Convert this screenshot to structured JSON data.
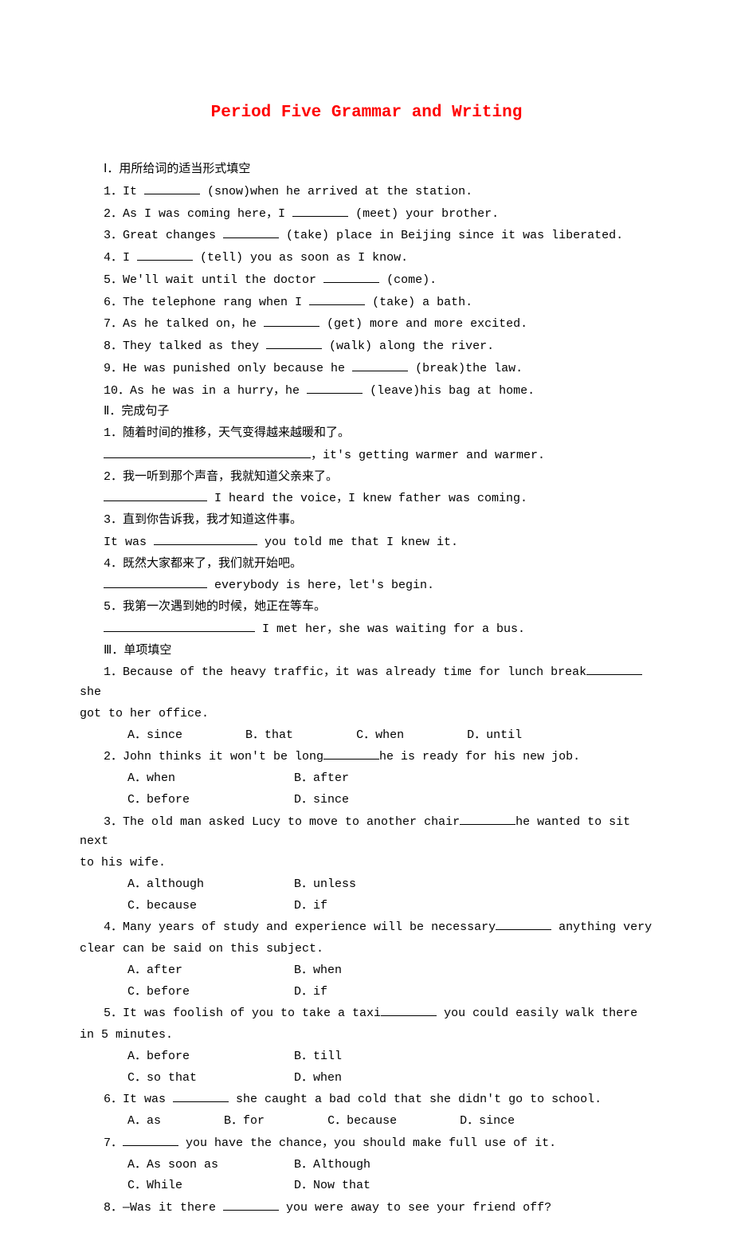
{
  "title": "Period Five  Grammar and Writing",
  "s1": {
    "header": "Ⅰ．用所给词的适当形式填空",
    "items": [
      {
        "n": "1．",
        "pre": "It ",
        "post": " (snow)when he arrived at the station."
      },
      {
        "n": "2．",
        "pre": "As I was coming here，I ",
        "post": " (meet) your brother."
      },
      {
        "n": "3．",
        "pre": "Great changes ",
        "post": " (take) place in Beijing since it was liberated."
      },
      {
        "n": "4．",
        "pre": "I ",
        "post": " (tell) you as soon as I know."
      },
      {
        "n": "5．",
        "pre": "We'll wait until the doctor ",
        "post": " (come)."
      },
      {
        "n": "6．",
        "pre": "The telephone rang when I ",
        "post": " (take) a bath."
      },
      {
        "n": "7．",
        "pre": "As he talked on，he ",
        "post": " (get) more and more excited."
      },
      {
        "n": "8．",
        "pre": "They talked as they ",
        "post": " (walk) along the river."
      },
      {
        "n": "9．",
        "pre": "He was punished only because he ",
        "post": " (break)the law."
      },
      {
        "n": "10．",
        "pre": "As he was in a hurry，he ",
        "post": " (leave)his bag at home."
      }
    ]
  },
  "s2": {
    "header": "Ⅱ．完成句子",
    "items": [
      {
        "n": "1．",
        "cn": "随着时间的推移，天气变得越来越暖和了。",
        "tail": "，it's getting warmer and warmer."
      },
      {
        "n": "2．",
        "cn": "我一听到那个声音，我就知道父亲来了。",
        "tail": " I heard the voice，I knew father was coming."
      },
      {
        "n": "3．",
        "cn": "直到你告诉我，我才知道这件事。",
        "lead": "It was ",
        "tail": " you told me that I knew it."
      },
      {
        "n": "4．",
        "cn": "既然大家都来了，我们就开始吧。",
        "tail": " everybody is here，let's begin."
      },
      {
        "n": "5．",
        "cn": "我第一次遇到她的时候，她正在等车。",
        "tail": " I met her，she was waiting for a bus."
      }
    ]
  },
  "s3": {
    "header": "Ⅲ．单项填空",
    "q1": {
      "pre": "1．Because of the heavy traffic，it was already time for lunch break",
      "post": "she",
      "cont": "got to her office.",
      "opts": [
        "A．since",
        "B．that",
        "C．when",
        "D．until"
      ]
    },
    "q2": {
      "pre": "2．John thinks it won't be long",
      "post": "he is ready for his new job.",
      "optsA": [
        "A．when",
        "B．after"
      ],
      "optsB": [
        "C．before",
        "D．since"
      ]
    },
    "q3": {
      "pre": "3．The old man asked Lucy to move to another chair",
      "post": "he wanted to sit next",
      "cont": "to his wife.",
      "optsA": [
        "A．although",
        "B．unless"
      ],
      "optsB": [
        "C．because",
        "D．if"
      ]
    },
    "q4": {
      "pre": "4．Many years of study and experience will be necessary ",
      "post": " anything very",
      "cont": "clear can be said on this subject.",
      "optsA": [
        "A．after",
        "B．when"
      ],
      "optsB": [
        "C．before",
        "D．if"
      ]
    },
    "q5": {
      "pre": "5．It was foolish of you to take a taxi ",
      "post": " you could easily walk there",
      "cont": "in 5 minutes.",
      "optsA": [
        "A．before",
        "B．till"
      ],
      "optsB": [
        "C．so that",
        "D．when"
      ]
    },
    "q6": {
      "pre": "6．It was ",
      "post": " she caught a bad cold that she didn't go to school.",
      "opts": [
        "A．as",
        "B．for",
        "C．because",
        "D．since"
      ]
    },
    "q7": {
      "pre": "7．",
      "post": " you have the chance，you should make full use of it.",
      "optsA": [
        "A．As soon as",
        "B．Although"
      ],
      "optsB": [
        "C．While",
        "D．Now that"
      ]
    },
    "q8": {
      "pre": "8．—Was it there ",
      "post": " you were away to see your friend off?"
    }
  }
}
